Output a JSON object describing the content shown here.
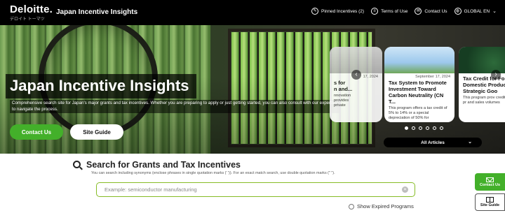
{
  "header": {
    "logo": "Deloitte.",
    "logo_sub": "デロイト トーマツ",
    "site_title": "Japan Incentive Insights",
    "nav": {
      "pinned": "Pinned Incentives (2)",
      "terms": "Terms of Use",
      "contact": "Contact Us",
      "language": "GLOBAL EN"
    }
  },
  "hero": {
    "title": "Japan Incentive Insights",
    "description": "Comprehensive search site for Japan's major grants and tax incentives. Whether you are preparing to apply or just getting started, you can also consult with our experts to navigate the process.",
    "contact_label": "Contact Us",
    "guide_label": "Site Guide"
  },
  "carousel": {
    "cards": [
      {
        "date": "17, 2024",
        "title": "s for\nn and...",
        "text": "nnovation\nprovides\nprivate"
      },
      {
        "date": "September 17, 2024",
        "title": "Tax System to Promote Investment Toward Carbon Neutrality (CN T...",
        "text": "This program offers a tax credit of 5% to 14% or a special depreciation of 50% for"
      },
      {
        "date": "",
        "title": "Tax Credit for Fo Domestic Produc the Strategic Goo",
        "text": "This program prov credits based on pr and sales volumes"
      }
    ],
    "all_articles_label": "All Articles",
    "dots_total": 6,
    "dots_active": 1
  },
  "search": {
    "title": "Search for Grants and Tax Incentives",
    "hint": "You can search including synonyms (enclose phrases in single quotation marks (' ')). For an exact match search, use double quotation marks (\" \").",
    "placeholder": "Example: semiconductor manufacturing",
    "expired_label": "Show Expired Programs"
  },
  "side": {
    "contact_label": "Contact Us",
    "guide_label": "Site Guide"
  },
  "colors": {
    "brand_green": "#86bc25",
    "button_green": "#43b02a",
    "header_bg": "#000000"
  }
}
